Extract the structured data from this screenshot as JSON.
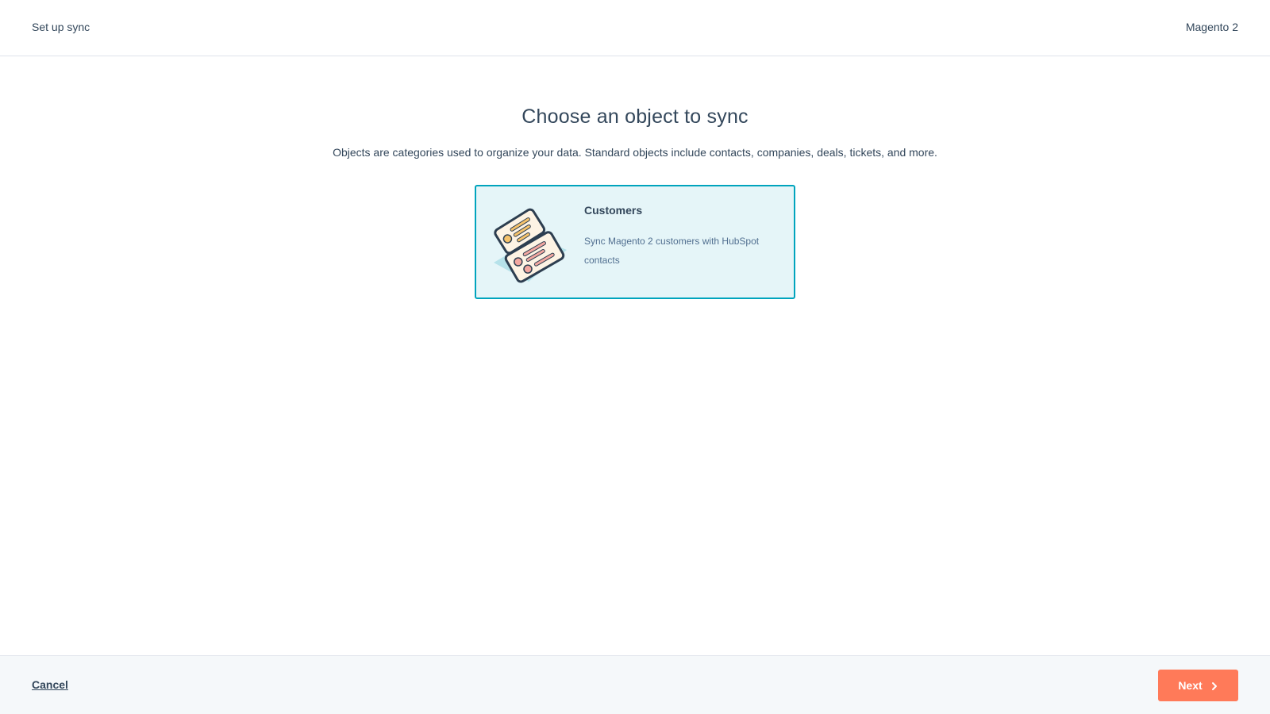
{
  "header": {
    "title": "Set up sync",
    "app_name": "Magento 2"
  },
  "main": {
    "heading": "Choose an object to sync",
    "subtitle": "Objects are categories used to organize your data. Standard objects include contacts, companies, deals, tickets, and more.",
    "cards": [
      {
        "title": "Customers",
        "description": "Sync Magento 2 customers with HubSpot contacts",
        "icon": "contact-cards-illustration",
        "selected": true
      }
    ]
  },
  "footer": {
    "cancel_label": "Cancel",
    "next_label": "Next",
    "next_icon": "chevron-right-icon"
  },
  "colors": {
    "accent": "#00a4bd",
    "card_selected_bg": "#e5f5f8",
    "primary_button": "#ff7a59",
    "text": "#33475b",
    "footer_bg": "#f5f8fa"
  }
}
